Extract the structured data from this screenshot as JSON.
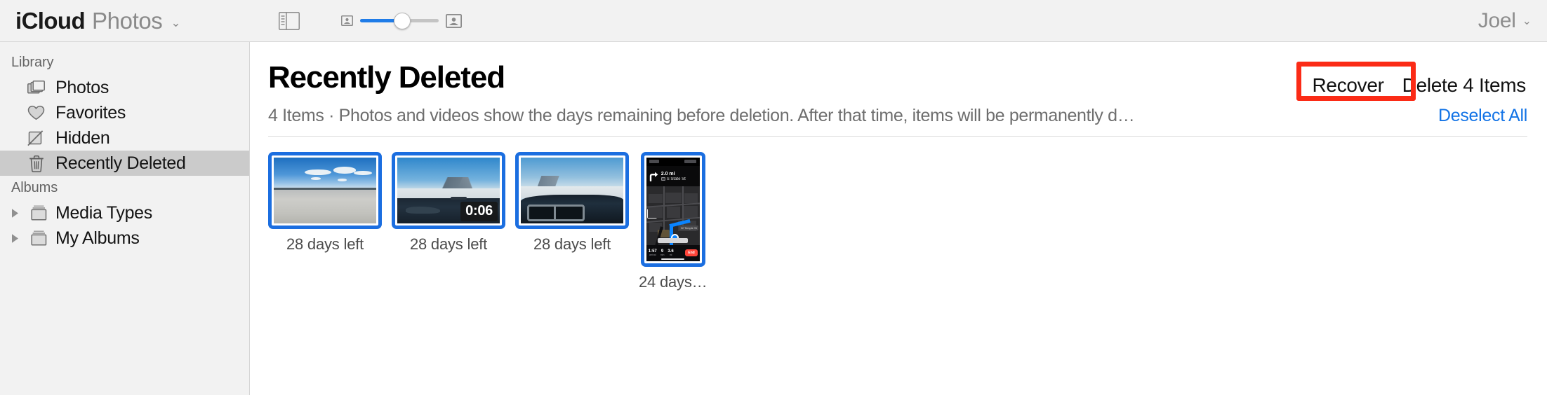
{
  "toolbar": {
    "brand_primary": "iCloud",
    "brand_secondary": "Photos",
    "brand_chevron": "⌄",
    "sidebar_toggle_name": "sidebar-toggle",
    "zoom_out_label": "small-thumbnail",
    "zoom_in_label": "large-thumbnail",
    "zoom_value_percent": 54,
    "account_name": "Joel",
    "account_chevron": "⌄"
  },
  "sidebar": {
    "sections": [
      {
        "header": "Library",
        "items": [
          {
            "label": "Photos",
            "icon": "photos-stack-icon",
            "selected": false,
            "has_triangle": false
          },
          {
            "label": "Favorites",
            "icon": "heart-icon",
            "selected": false,
            "has_triangle": false
          },
          {
            "label": "Hidden",
            "icon": "hidden-eye-slash-icon",
            "selected": false,
            "has_triangle": false
          },
          {
            "label": "Recently Deleted",
            "icon": "trash-icon",
            "selected": true,
            "has_triangle": false
          }
        ]
      },
      {
        "header": "Albums",
        "items": [
          {
            "label": "Media Types",
            "icon": "album-stack-icon",
            "selected": false,
            "has_triangle": true
          },
          {
            "label": "My Albums",
            "icon": "album-stack-icon",
            "selected": false,
            "has_triangle": true
          }
        ]
      }
    ]
  },
  "main": {
    "title": "Recently Deleted",
    "item_count_label": "4 Items",
    "separator": "·",
    "description": "Photos and videos show the days remaining before deletion. After that time, items will be permanently d…",
    "subtitle_full": "4 Items  ·  Photos and videos show the days remaining before deletion. After that time, items will be permanently d…",
    "recover_label": "Recover",
    "delete_label": "Delete 4 Items",
    "deselect_label": "Deselect All",
    "annotation_color": "#fb2b16",
    "selection_color": "#1b6ee0",
    "link_color": "#1273e6"
  },
  "grid": {
    "items": [
      {
        "kind": "photo",
        "orientation": "landscape",
        "scene": "salt-flats-landscape",
        "caption": "28 days left",
        "selected": true,
        "duration": null
      },
      {
        "kind": "video",
        "orientation": "landscape",
        "scene": "car-dashboard-salt-flats",
        "caption": "28 days left",
        "selected": true,
        "duration": "0:06"
      },
      {
        "kind": "photo",
        "orientation": "landscape",
        "scene": "car-dashboard-vent",
        "caption": "28 days left",
        "selected": true,
        "duration": null
      },
      {
        "kind": "screenshot",
        "orientation": "portrait",
        "scene": "maps-navigation-dark",
        "caption": "24 days…",
        "selected": true,
        "duration": null,
        "maps": {
          "distance": "2.0 mi",
          "street": "S State St",
          "eta_stats": [
            {
              "value": "1:57",
              "unit": "arrival"
            },
            {
              "value": "9",
              "unit": "min"
            },
            {
              "value": "3.6",
              "unit": "mi"
            }
          ],
          "end_button": "End",
          "road_label": "W Temple St"
        }
      }
    ]
  }
}
